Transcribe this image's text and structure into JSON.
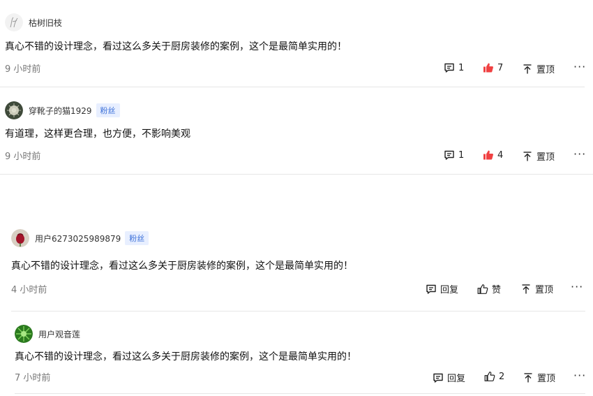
{
  "comments": [
    {
      "username": "枯树旧枝",
      "badge": "",
      "text": "真心不错的设计理念，看过这么多关于厨房装修的案例，这个是最简单实用的！",
      "time": "9 小时前",
      "reply_count": "1",
      "like_count": "7",
      "liked": true,
      "pin_label": "置顶",
      "more_label": "···"
    },
    {
      "username": "穿靴子的猫1929",
      "badge": "粉丝",
      "text": "有道理，这样更合理，也方便，不影响美观",
      "time": "9 小时前",
      "reply_count": "1",
      "like_count": "4",
      "liked": true,
      "pin_label": "置顶",
      "more_label": "···"
    },
    {
      "username": "用户6273025989879",
      "badge": "粉丝",
      "text": "真心不错的设计理念，看过这么多关于厨房装修的案例，这个是最简单实用的！",
      "time": "4 小时前",
      "reply_label": "回复",
      "like_label": "赞",
      "liked": false,
      "pin_label": "置顶",
      "more_label": "···"
    },
    {
      "username": "用户观音莲",
      "badge": "",
      "text": "真心不错的设计理念，看过这么多关于厨房装修的案例，这个是最简单实用的！",
      "time": "7 小时前",
      "reply_label": "回复",
      "like_count": "2",
      "liked": false,
      "pin_label": "置顶",
      "more_label": "···"
    }
  ],
  "colors": {
    "like_active": "#f04142",
    "badge_text": "#3a6fd8",
    "badge_bg": "#e8efff",
    "divider": "#e6e6e6"
  }
}
